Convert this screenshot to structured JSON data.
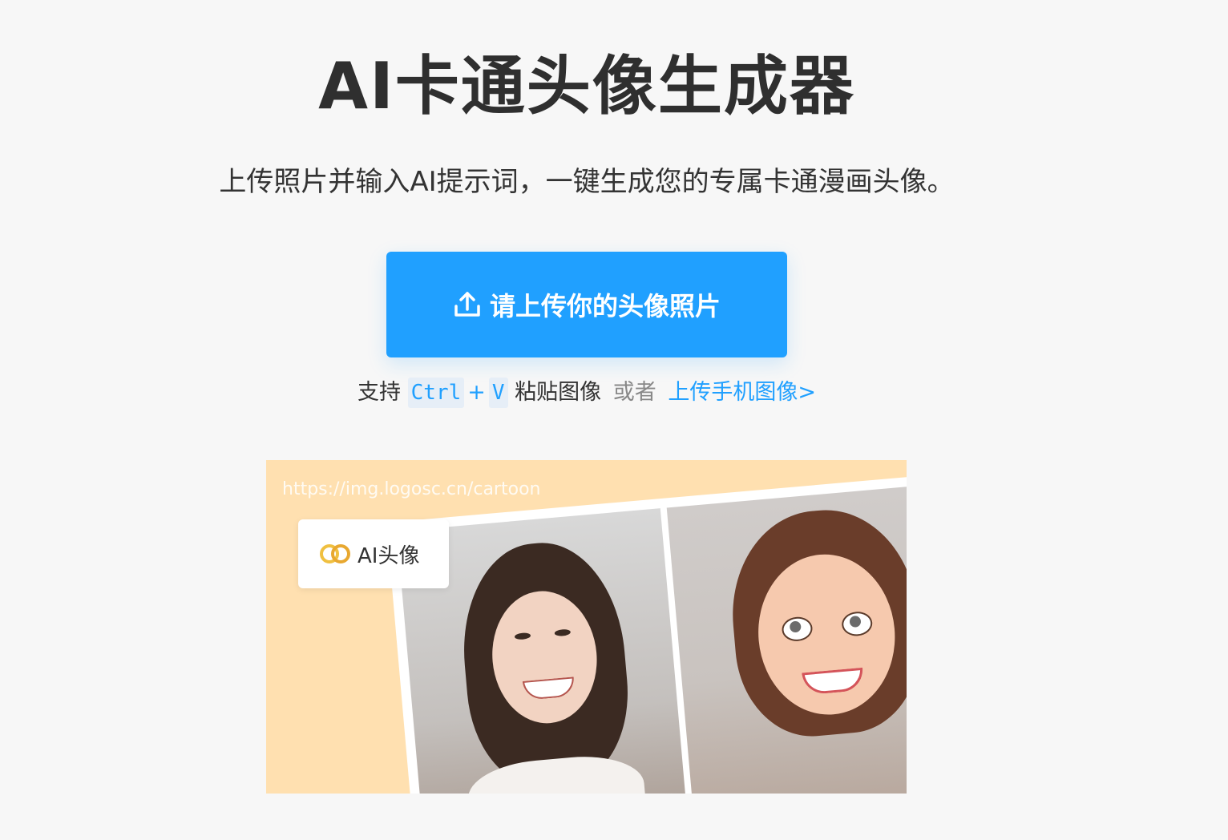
{
  "header": {
    "title": "AI卡通头像生成器",
    "subtitle": "上传照片并输入AI提示词，一键生成您的专属卡通漫画头像。"
  },
  "upload": {
    "button_label": "请上传你的头像照片",
    "icon": "upload-icon",
    "color": "#20a0ff"
  },
  "hint": {
    "support": "支持",
    "key_ctrl": "Ctrl",
    "plus": "+",
    "key_v": "V",
    "paste": "粘贴图像",
    "or": "或者",
    "mobile_link": "上传手机图像>"
  },
  "demo": {
    "url": "https://img.logosc.cn/cartoon",
    "badge_label": "AI头像",
    "badge_icon": "ai-avatar-logo-icon",
    "background_color": "#ffe0b0"
  }
}
